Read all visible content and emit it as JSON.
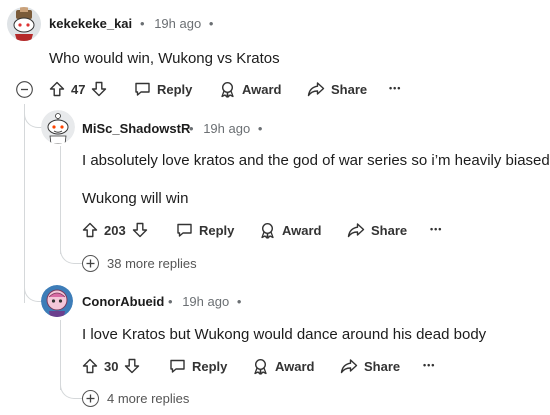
{
  "comments": [
    {
      "username": "kekekeke_kai",
      "time": "19h ago",
      "separator": "•",
      "body": [
        "Who would win, Wukong vs Kratos"
      ],
      "votes": "47",
      "actions": {
        "reply": "Reply",
        "award": "Award",
        "share": "Share",
        "more": "•••"
      }
    },
    {
      "username": "MiSc_ShadowstR",
      "time": "19h ago",
      "separator": "•",
      "body": [
        "I absolutely love kratos and the god of war series so i’m heavily biased.",
        "Wukong will win"
      ],
      "votes": "203",
      "actions": {
        "reply": "Reply",
        "award": "Award",
        "share": "Share",
        "more": "•••"
      },
      "more_replies": "38 more replies"
    },
    {
      "username": "ConorAbueid",
      "time": "19h ago",
      "separator": "•",
      "body": [
        "I love Kratos but Wukong would dance around his dead body"
      ],
      "votes": "30",
      "actions": {
        "reply": "Reply",
        "award": "Award",
        "share": "Share",
        "more": "•••"
      },
      "more_replies": "4 more replies"
    }
  ]
}
